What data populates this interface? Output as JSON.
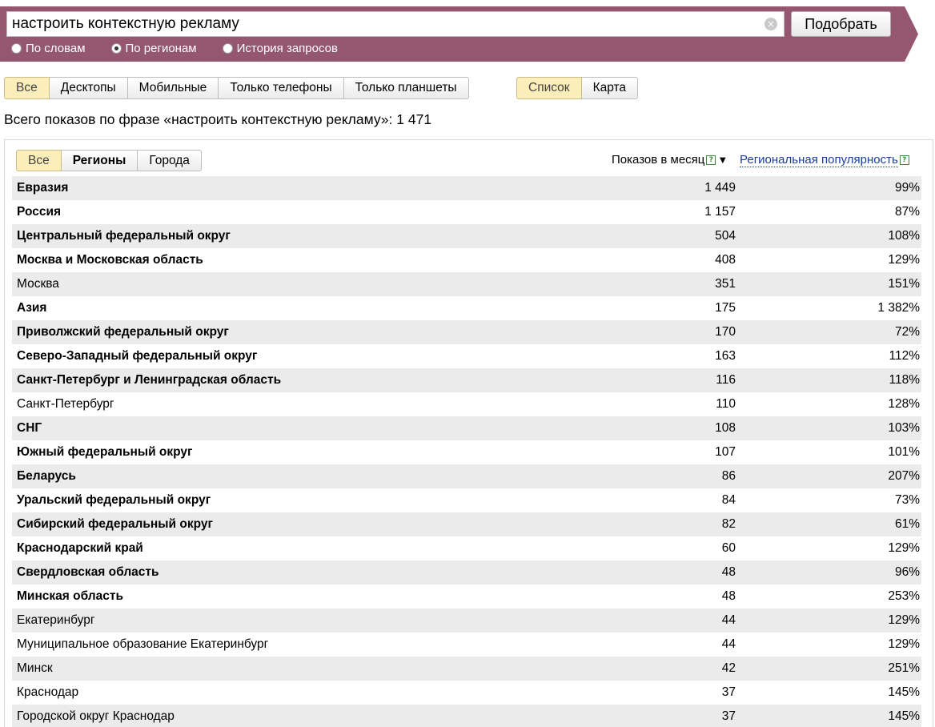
{
  "search": {
    "query": "настроить контекстную рекламу",
    "submit_label": "Подобрать",
    "clear_glyph": "×"
  },
  "search_modes": [
    {
      "label": "По словам",
      "checked": false
    },
    {
      "label": "По регионам",
      "checked": true
    },
    {
      "label": "История запросов",
      "checked": false
    }
  ],
  "device_filter": [
    "Все",
    "Десктопы",
    "Мобильные",
    "Только телефоны",
    "Только планшеты"
  ],
  "device_filter_active": "Все",
  "view_toggle": [
    "Список",
    "Карта"
  ],
  "view_toggle_active": "Список",
  "summary": "Всего показов по фразе «настроить контекстную рекламу»: 1 471",
  "region_filter": [
    "Все",
    "Регионы",
    "Города"
  ],
  "region_filter_active": "Все",
  "columns": {
    "shows": "Показов в месяц",
    "popularity": "Региональная популярность",
    "help_glyph": "?",
    "sort_glyph": "▼"
  },
  "colors": {
    "band": "#955670",
    "active_button": "#fbeeb8",
    "link": "#1a3d99"
  },
  "rows": [
    {
      "name": "Евразия",
      "shows": "1 449",
      "popularity": "99%",
      "bold": true
    },
    {
      "name": "Россия",
      "shows": "1 157",
      "popularity": "87%",
      "bold": true
    },
    {
      "name": "Центральный федеральный округ",
      "shows": "504",
      "popularity": "108%",
      "bold": true
    },
    {
      "name": "Москва и Московская область",
      "shows": "408",
      "popularity": "129%",
      "bold": true
    },
    {
      "name": "Москва",
      "shows": "351",
      "popularity": "151%",
      "bold": false
    },
    {
      "name": "Азия",
      "shows": "175",
      "popularity": "1 382%",
      "bold": true
    },
    {
      "name": "Приволжский федеральный округ",
      "shows": "170",
      "popularity": "72%",
      "bold": true
    },
    {
      "name": "Северо-Западный федеральный округ",
      "shows": "163",
      "popularity": "112%",
      "bold": true
    },
    {
      "name": "Санкт-Петербург и Ленинградская область",
      "shows": "116",
      "popularity": "118%",
      "bold": true
    },
    {
      "name": "Санкт-Петербург",
      "shows": "110",
      "popularity": "128%",
      "bold": false
    },
    {
      "name": "СНГ",
      "shows": "108",
      "popularity": "103%",
      "bold": true
    },
    {
      "name": "Южный федеральный округ",
      "shows": "107",
      "popularity": "101%",
      "bold": true
    },
    {
      "name": "Беларусь",
      "shows": "86",
      "popularity": "207%",
      "bold": true
    },
    {
      "name": "Уральский федеральный округ",
      "shows": "84",
      "popularity": "73%",
      "bold": true
    },
    {
      "name": "Сибирский федеральный округ",
      "shows": "82",
      "popularity": "61%",
      "bold": true
    },
    {
      "name": "Краснодарский край",
      "shows": "60",
      "popularity": "129%",
      "bold": true
    },
    {
      "name": "Свердловская область",
      "shows": "48",
      "popularity": "96%",
      "bold": true
    },
    {
      "name": "Минская область",
      "shows": "48",
      "popularity": "253%",
      "bold": true
    },
    {
      "name": "Екатеринбург",
      "shows": "44",
      "popularity": "129%",
      "bold": false
    },
    {
      "name": "Муниципальное образование Екатеринбург",
      "shows": "44",
      "popularity": "129%",
      "bold": false
    },
    {
      "name": "Минск",
      "shows": "42",
      "popularity": "251%",
      "bold": false
    },
    {
      "name": "Краснодар",
      "shows": "37",
      "popularity": "145%",
      "bold": false
    },
    {
      "name": "Городской округ Краснодар",
      "shows": "37",
      "popularity": "145%",
      "bold": false
    }
  ]
}
